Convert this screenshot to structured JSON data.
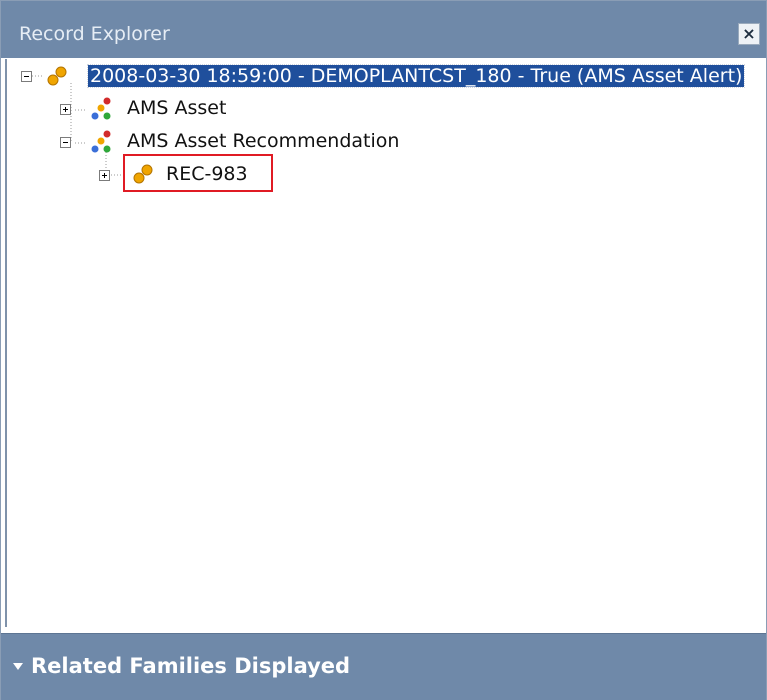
{
  "panel": {
    "title": "Record Explorer",
    "close_label": "×"
  },
  "tree": {
    "root": {
      "label": "2008-03-30 18:59:00 - DEMOPLANTCST_180 - True (AMS Asset Alert)",
      "expanded": true,
      "icon": "record-icon"
    },
    "children": [
      {
        "label": "AMS Asset",
        "expanded": false,
        "icon": "family-icon"
      },
      {
        "label": "AMS Asset Recommendation",
        "expanded": true,
        "icon": "family-icon"
      }
    ],
    "grandchildren": [
      {
        "label": "REC-983",
        "expanded": false,
        "icon": "record-icon",
        "highlighted": true
      }
    ]
  },
  "footer": {
    "label": "Related Families Displayed"
  },
  "colors": {
    "header_bg": "#6f89a9",
    "selection": "#1f4f9c",
    "highlight": "#e01b24"
  }
}
